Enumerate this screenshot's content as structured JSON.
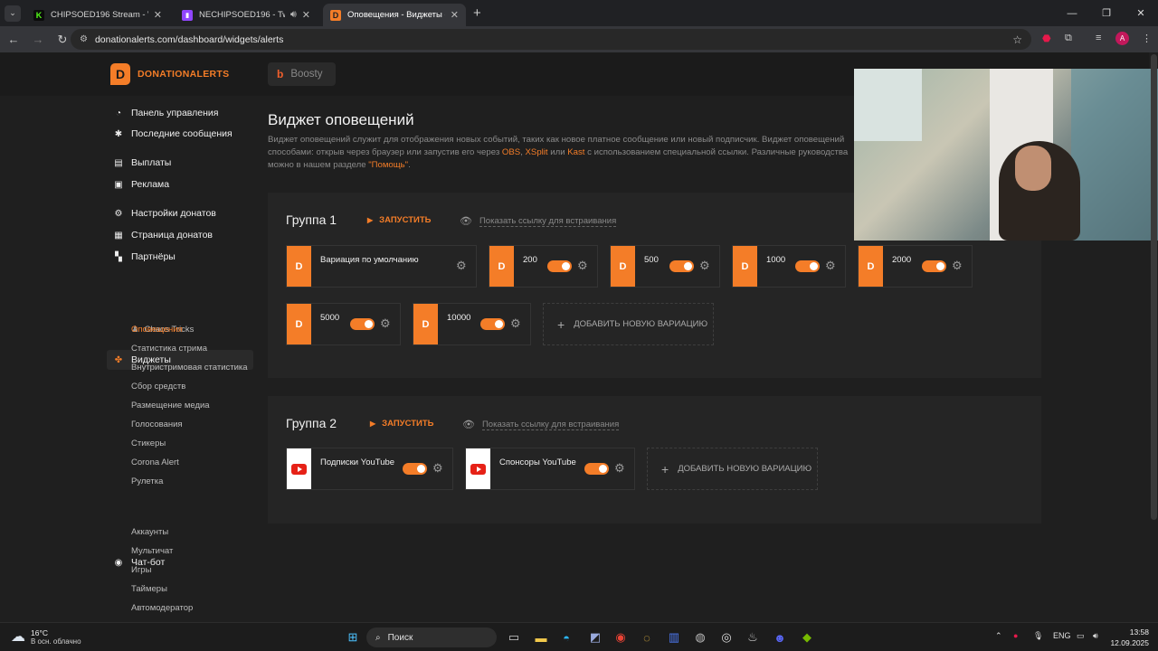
{
  "browser": {
    "tabs": [
      {
        "title": "CHIPSOED196 Stream - Watch I",
        "fav_color": "#53fc18",
        "fav_glyph": "K"
      },
      {
        "title": "NECHIPSOED196 - Twitch",
        "fav_color": "#9146ff",
        "fav_glyph": "▮"
      },
      {
        "title": "Оповещения - Виджеты - Don",
        "fav_color": "#f47d28",
        "fav_glyph": "D"
      }
    ],
    "url": "donationalerts.com/dashboard/widgets/alerts",
    "avatar_letter": "A"
  },
  "site": {
    "logo_text": "DONATIONALERTS",
    "boosty_label": "Boosty"
  },
  "sidebar": {
    "items": [
      {
        "label": "Панель управления",
        "icon": "dashboard-icon"
      },
      {
        "label": "Последние сообщения",
        "icon": "messages-icon"
      },
      {
        "label": "Выплаты",
        "icon": "payouts-icon"
      },
      {
        "label": "Реклама",
        "icon": "ads-icon"
      },
      {
        "label": "Настройки донатов",
        "icon": "settings-icon"
      },
      {
        "label": "Страница донатов",
        "icon": "page-icon"
      },
      {
        "label": "Партнёры",
        "icon": "partners-icon"
      },
      {
        "label": "Виджеты",
        "icon": "widgets-icon"
      },
      {
        "label": "Чат-бот",
        "icon": "chatbot-icon"
      }
    ],
    "partner_sub": "Chaos Tricks",
    "widget_subs": [
      "Оповещения",
      "Статистика стрима",
      "Внутристримовая статистика",
      "Сбор средств",
      "Размещение медиа",
      "Голосования",
      "Стикеры",
      "Corona Alert",
      "Рулетка"
    ],
    "chatbot_subs": [
      "Аккаунты",
      "Мультичат",
      "Игры",
      "Таймеры",
      "Автомодератор"
    ]
  },
  "main": {
    "title": "Виджет оповещений",
    "desc_1": "Виджет оповещений служит для отображения новых событий, таких как новое платное сообщение или новый подписчик. Виджет оповещений",
    "desc_2": "способами: открыв через браузер или запустив его через ",
    "desc_obs": "OBS",
    "desc_xsplit": "XSplit",
    "desc_or": " или ",
    "desc_kast": "Kast",
    "desc_3": " с использованием специальной ссылки. Различные руководства",
    "desc_4": "можно в нашем разделе ",
    "desc_help": "\"Помощь\"",
    "desc_dot": ".",
    "groups": [
      {
        "title": "Группа 1",
        "run_label": "ЗАПУСТИТЬ",
        "embed_label": "Показать ссылку для встраивания",
        "variations": [
          "Вариация по умолчанию",
          "200",
          "500",
          "1000",
          "2000",
          "5000",
          "10000"
        ],
        "add_label": "ДОБАВИТЬ НОВУЮ ВАРИАЦИЮ"
      },
      {
        "title": "Группа 2",
        "run_label": "ЗАПУСТИТЬ",
        "embed_label": "Показать ссылку для встраивания",
        "variations": [
          "Подписки YouTube",
          "Спонсоры YouTube"
        ],
        "add_label": "ДОБАВИТЬ НОВУЮ ВАРИАЦИЮ"
      }
    ]
  },
  "taskbar": {
    "temp": "16°C",
    "weather": "В осн. облачно",
    "search": "Поиск",
    "lang": "ENG",
    "time": "13:58",
    "date": "12.09.2025"
  },
  "colors": {
    "accent": "#f47d28",
    "youtube": "#e62117"
  }
}
